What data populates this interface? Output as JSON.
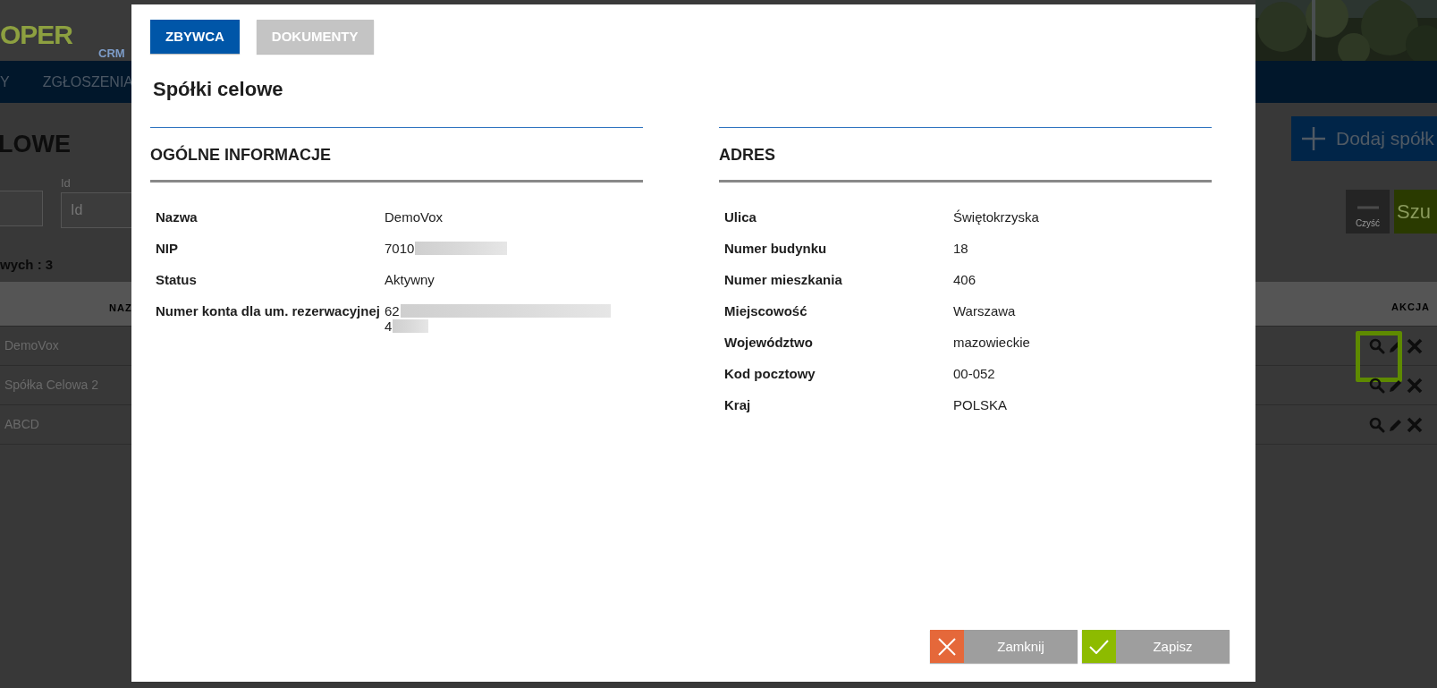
{
  "background_page": {
    "logo": {
      "text": "OPER",
      "subtext": "CRM"
    },
    "nav_items": [
      "Y",
      "ZGŁOSZENIA"
    ],
    "heading": "LOWE",
    "filter_fields": [
      {
        "label": "Id",
        "placeholder": "Id"
      }
    ],
    "add_button": "Dodaj spółk",
    "clear_button": "Czyść",
    "search_button": "Szu",
    "count_text": "wych : 3",
    "table": {
      "columns": [
        "NAZ",
        "AKCJA"
      ],
      "rows": [
        {
          "name": "DemoVox",
          "highlighted": true
        },
        {
          "name": "Spółka Celowa 2",
          "highlighted": false
        },
        {
          "name": "ABCD",
          "highlighted": false
        }
      ]
    }
  },
  "modal": {
    "tabs": [
      {
        "label": "ZBYWCA",
        "selected": true
      },
      {
        "label": "DOKUMENTY",
        "selected": false
      }
    ],
    "title": "Spółki celowe",
    "sections": [
      {
        "heading": "OGÓLNE INFORMACJE",
        "fields": [
          {
            "label": "Nazwa",
            "value": "DemoVox"
          },
          {
            "label": "NIP",
            "value": "7010",
            "redacted": true
          },
          {
            "label": "Status",
            "value": "Aktywny"
          },
          {
            "label": "Numer konta dla um. rezerwacyjnej",
            "value_lines": [
              {
                "text": "62",
                "redacted": true
              },
              {
                "text": "4",
                "redacted": true
              }
            ]
          }
        ]
      },
      {
        "heading": "ADRES",
        "fields": [
          {
            "label": "Ulica",
            "value": "Świętokrzyska"
          },
          {
            "label": "Numer budynku",
            "value": "18"
          },
          {
            "label": "Numer mieszkania",
            "value": "406"
          },
          {
            "label": "Miejscowość",
            "value": "Warszawa"
          },
          {
            "label": "Województwo",
            "value": "mazowieckie"
          },
          {
            "label": "Kod pocztowy",
            "value": "00-052"
          },
          {
            "label": "Kraj",
            "value": "POLSKA"
          }
        ]
      }
    ],
    "buttons": [
      {
        "label": "Zamknij",
        "kind": "close"
      },
      {
        "label": "Zapisz",
        "kind": "save"
      }
    ]
  }
}
